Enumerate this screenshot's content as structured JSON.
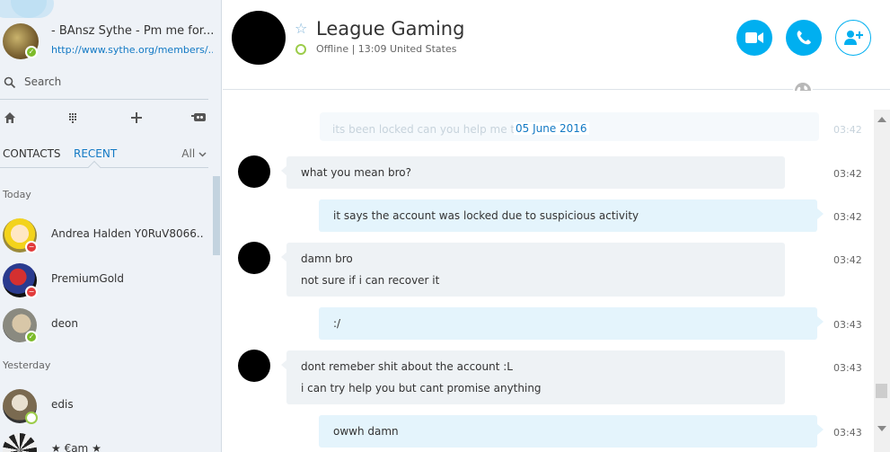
{
  "profile": {
    "name": "- BAnsz Sythe - Pm me for...",
    "mood": "http://www.sythe.org/members/...",
    "status": "online"
  },
  "search": {
    "placeholder": "Search"
  },
  "nav": {
    "icons": [
      "home-icon",
      "dialpad-icon",
      "add-icon",
      "bot-icon"
    ]
  },
  "tabs": {
    "contacts": "CONTACTS",
    "recent": "RECENT",
    "filter": "All",
    "active": "RECENT"
  },
  "groups": {
    "today": "Today",
    "yesterday": "Yesterday"
  },
  "contacts": [
    {
      "name": "Andrea Halden Y0RuV8066...",
      "status": "busy",
      "group": "Today"
    },
    {
      "name": "PremiumGold",
      "status": "busy",
      "group": "Today"
    },
    {
      "name": "deon",
      "status": "online",
      "group": "Today"
    },
    {
      "name": "edis",
      "status": "offline",
      "group": "Yesterday"
    },
    {
      "name": "★ €am ★",
      "status": "",
      "group": "Yesterday"
    }
  ],
  "conversation": {
    "title": "League Gaming",
    "status": "Offline",
    "local_time": "13:09 United States",
    "favorite": false
  },
  "header_buttons": {
    "video": "video-call",
    "call": "audio-call",
    "add": "add-participant"
  },
  "messages": {
    "previous_text": "its been locked can you help me to",
    "previous_time": "03:42",
    "date_divider": "05 June 2016",
    "items": [
      {
        "direction": "in",
        "lines": [
          "what you mean bro?"
        ],
        "time": "03:42"
      },
      {
        "direction": "out",
        "lines": [
          "it says the account was locked due to suspicious activity"
        ],
        "time": "03:42"
      },
      {
        "direction": "in",
        "lines": [
          "damn bro",
          "not sure if i can recover it"
        ],
        "time": "03:42"
      },
      {
        "direction": "out",
        "lines": [
          ":/"
        ],
        "time": "03:43"
      },
      {
        "direction": "in",
        "lines": [
          "dont remeber shit about the account :L",
          "i can try help you but cant promise anything"
        ],
        "time": "03:43"
      },
      {
        "direction": "out",
        "lines": [
          "owwh damn"
        ],
        "time": "03:43"
      }
    ]
  },
  "colors": {
    "accent": "#00aff0",
    "link": "#1279c4",
    "online": "#7dbb2a",
    "busy": "#e23b3b",
    "bubble_in": "#eef2f5",
    "bubble_out": "#e4f4fc"
  }
}
